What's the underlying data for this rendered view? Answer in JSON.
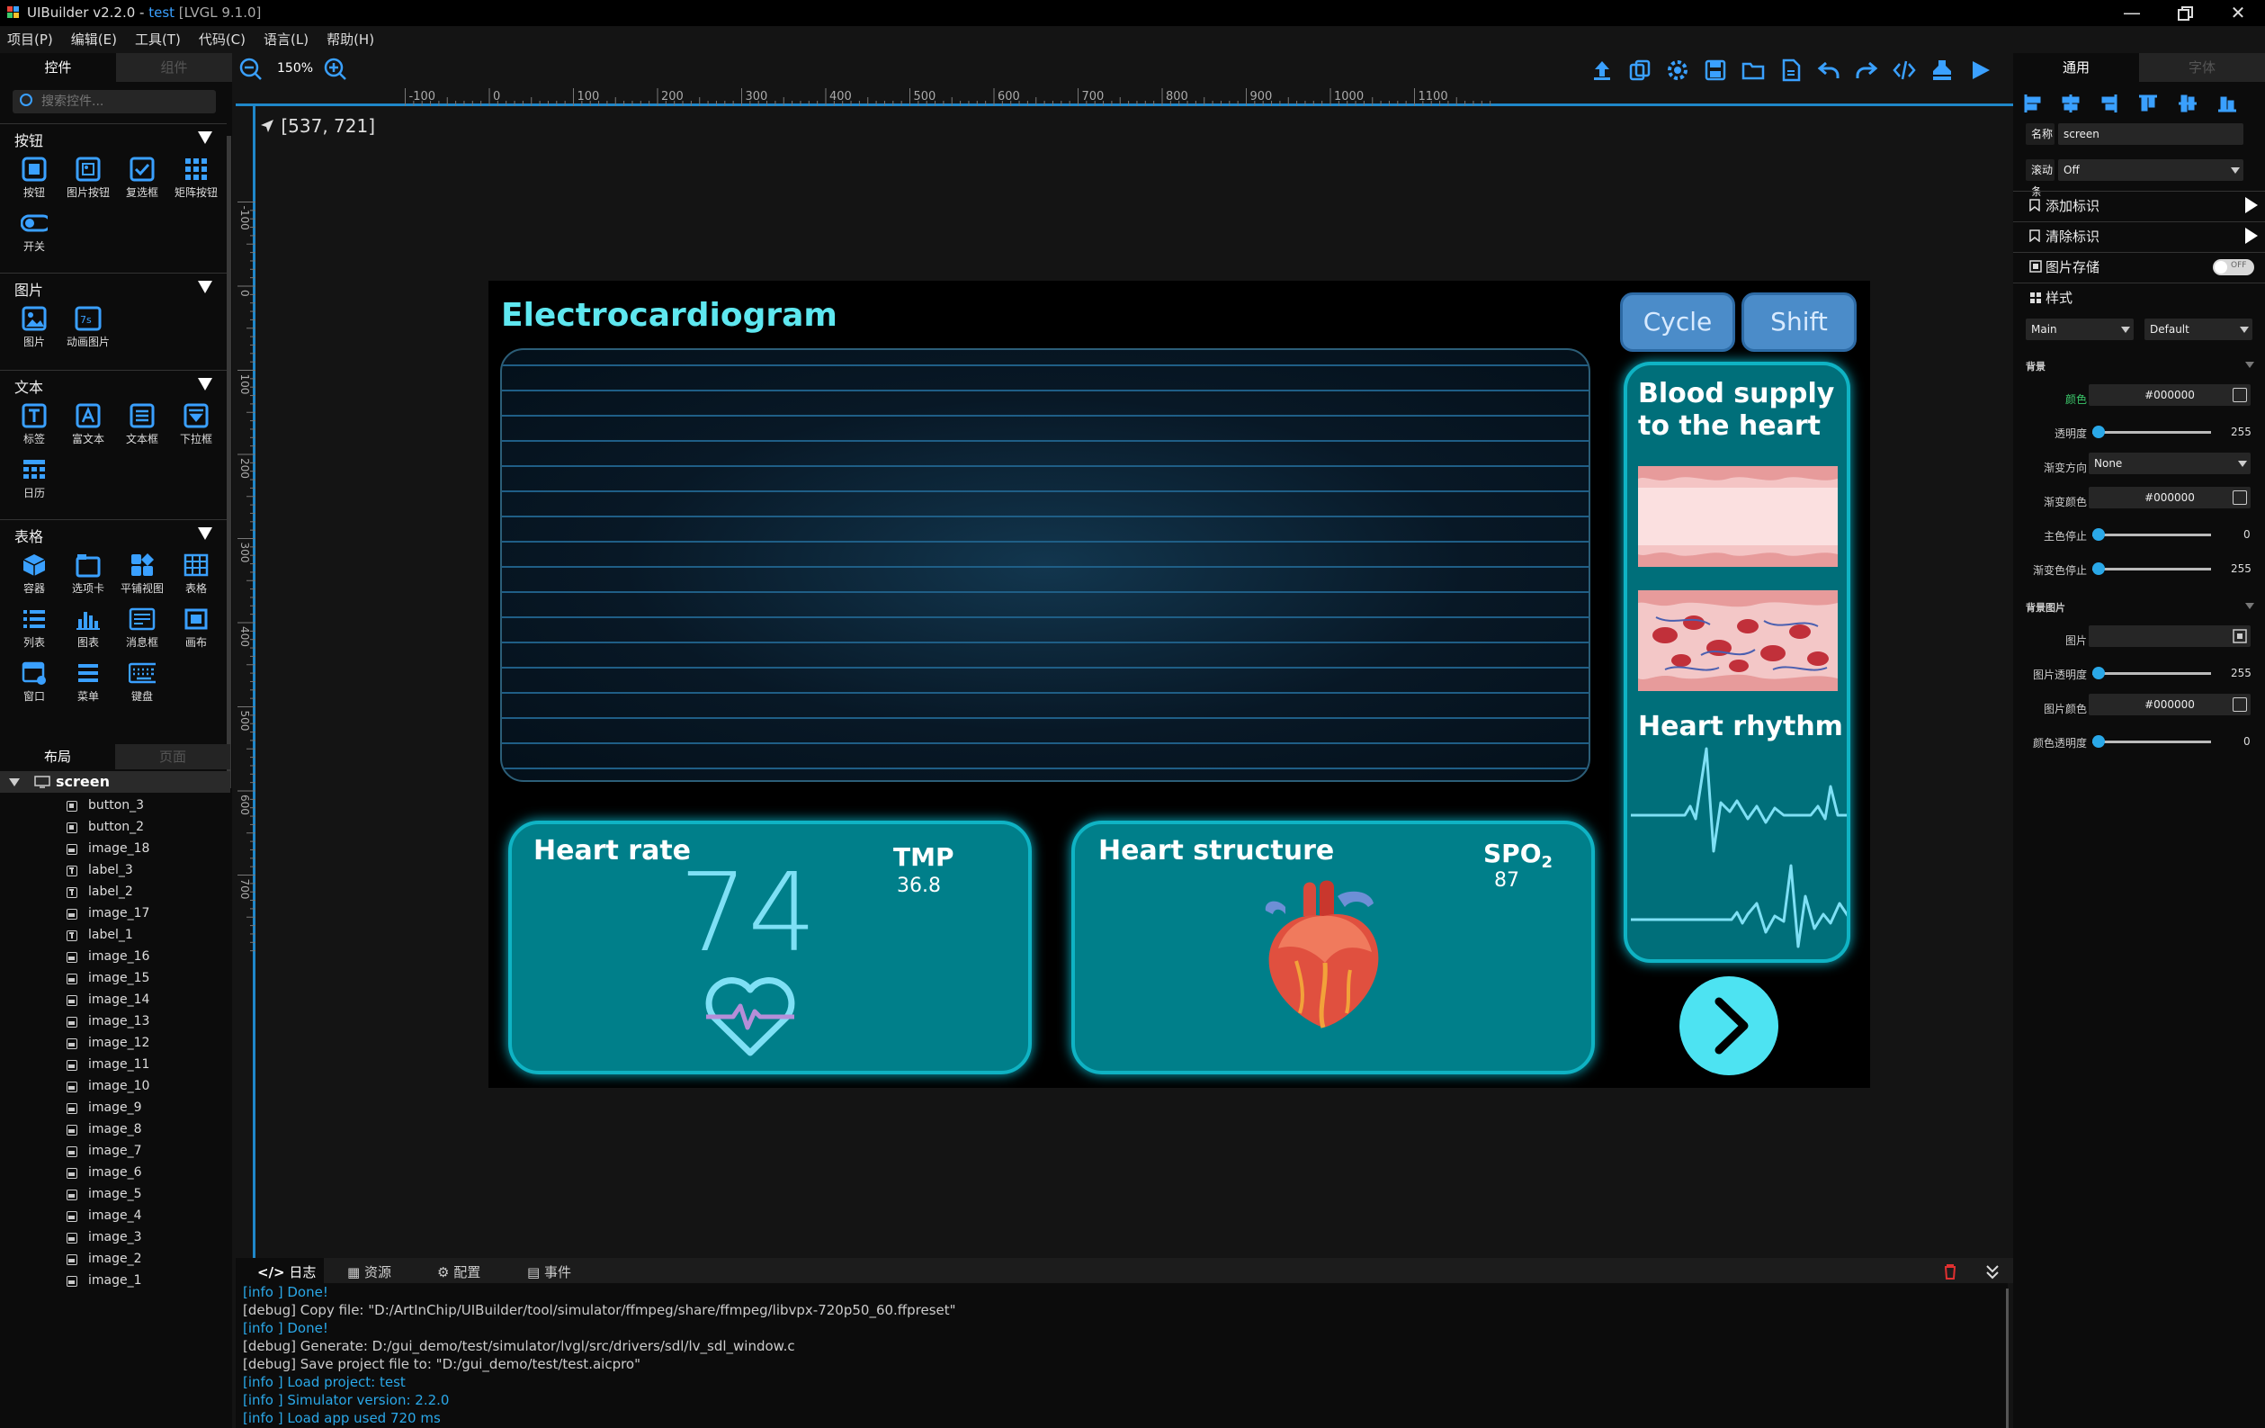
{
  "window": {
    "app_name": "UIBuilder v2.2.0 - ",
    "project": "test",
    "lvgl": " [LVGL 9.1.0]"
  },
  "menu": [
    "项目(P)",
    "编辑(E)",
    "工具(T)",
    "代码(C)",
    "语言(L)",
    "帮助(H)"
  ],
  "left_panel": {
    "tabs": [
      "控件",
      "组件"
    ],
    "search_placeholder": "搜索控件...",
    "categories": [
      {
        "name": "按钮",
        "items": [
          "按钮",
          "图片按钮",
          "复选框",
          "矩阵按钮",
          "开关"
        ]
      },
      {
        "name": "图片",
        "items": [
          "图片",
          "动画图片"
        ]
      },
      {
        "name": "文本",
        "items": [
          "标签",
          "富文本",
          "文本框",
          "下拉框",
          "日历"
        ]
      },
      {
        "name": "表格",
        "items": [
          "容器",
          "选项卡",
          "平铺视图",
          "表格",
          "列表",
          "图表",
          "消息框",
          "画布",
          "窗口",
          "菜单",
          "键盘"
        ]
      }
    ],
    "layout_tabs": [
      "布局",
      "页面"
    ],
    "tree_root": "screen",
    "tree": [
      {
        "type": "button",
        "name": "button_3"
      },
      {
        "type": "button",
        "name": "button_2"
      },
      {
        "type": "image",
        "name": "image_18"
      },
      {
        "type": "label",
        "name": "label_3"
      },
      {
        "type": "label",
        "name": "label_2"
      },
      {
        "type": "image",
        "name": "image_17"
      },
      {
        "type": "label",
        "name": "label_1"
      },
      {
        "type": "image",
        "name": "image_16"
      },
      {
        "type": "image",
        "name": "image_15"
      },
      {
        "type": "image",
        "name": "image_14"
      },
      {
        "type": "image",
        "name": "image_13"
      },
      {
        "type": "image",
        "name": "image_12"
      },
      {
        "type": "image",
        "name": "image_11"
      },
      {
        "type": "image",
        "name": "image_10"
      },
      {
        "type": "image",
        "name": "image_9"
      },
      {
        "type": "image",
        "name": "image_8"
      },
      {
        "type": "image",
        "name": "image_7"
      },
      {
        "type": "image",
        "name": "image_6"
      },
      {
        "type": "image",
        "name": "image_5"
      },
      {
        "type": "image",
        "name": "image_4"
      },
      {
        "type": "image",
        "name": "image_3"
      },
      {
        "type": "image",
        "name": "image_2"
      },
      {
        "type": "image",
        "name": "image_1"
      }
    ]
  },
  "toolbar": {
    "zoom": "150%",
    "tools": [
      "upload-icon",
      "copy-icon",
      "settings-icon",
      "save-icon",
      "open-folder-icon",
      "new-file-icon",
      "undo-icon",
      "redo-icon",
      "code-icon",
      "build-icon",
      "run-icon"
    ]
  },
  "rulers": {
    "h_labels": [
      "-100",
      "0",
      "100",
      "200",
      "300",
      "400",
      "500",
      "600",
      "700",
      "800",
      "900",
      "1000",
      "1100"
    ],
    "v_labels": [
      "-100",
      "0",
      "100",
      "200",
      "300",
      "400",
      "500",
      "600",
      "700"
    ]
  },
  "canvas": {
    "cursor_coord": "[537, 721]"
  },
  "device": {
    "title": "Electrocardiogram",
    "btn_cycle": "Cycle",
    "btn_shift": "Shift",
    "heart_rate": {
      "title": "Heart rate",
      "value": "74",
      "tmp_label": "TMP",
      "tmp_value": "36.8"
    },
    "heart_structure": {
      "title": "Heart structure",
      "spo_label": "SPO",
      "spo_sub": "2",
      "spo_value": "87"
    },
    "side": {
      "title": "Blood supply to the heart",
      "rhythm_title": "Heart rhythm"
    }
  },
  "log": {
    "tabs": [
      "日志",
      "资源",
      "配置",
      "事件"
    ],
    "lines": [
      {
        "level": "info",
        "text": "[info ] Done!"
      },
      {
        "level": "debug",
        "text": "[debug] Copy file: \"D:/ArtInChip/UIBuilder/tool/simulator/ffmpeg/share/ffmpeg/libvpx-720p50_60.ffpreset\""
      },
      {
        "level": "info",
        "text": "[info ] Done!"
      },
      {
        "level": "debug",
        "text": "[debug] Generate: D:/gui_demo/test/simulator/lvgl/src/drivers/sdl/lv_sdl_window.c"
      },
      {
        "level": "debug",
        "text": "[debug] Save project file to: \"D:/gui_demo/test/test.aicpro\""
      },
      {
        "level": "info",
        "text": "[info ] Load project: test"
      },
      {
        "level": "info",
        "text": "[info ] Simulator version: 2.2.0"
      },
      {
        "level": "info",
        "text": "[info ] Load app used 720 ms"
      }
    ]
  },
  "right_panel": {
    "tabs": [
      "通用",
      "字体"
    ],
    "name_label": "名称",
    "name_value": "screen",
    "scroll_label": "滚动条",
    "scroll_value": "Off",
    "add_flag": "添加标识",
    "clear_flag": "清除标识",
    "img_store": "图片存储",
    "img_store_toggle": "OFF",
    "style_title": "样式",
    "style_part": "Main",
    "style_state": "Default",
    "bg_section": "背景",
    "bg_img_section": "背景图片",
    "props": {
      "color_label": "颜色",
      "color_value": "#000000",
      "opa_label": "透明度",
      "opa_value": "255",
      "grad_dir_label": "渐变方向",
      "grad_dir_value": "None",
      "grad_color_label": "渐变颜色",
      "grad_color_value": "#000000",
      "main_stop_label": "主色停止",
      "main_stop_value": "0",
      "grad_stop_label": "渐变色停止",
      "grad_stop_value": "255",
      "img_label": "图片",
      "img_opa_label": "图片透明度",
      "img_opa_value": "255",
      "img_color_label": "图片颜色",
      "img_color_value": "#000000",
      "color_opa_label": "颜色透明度",
      "color_opa_value": "0"
    },
    "slider_levels": {
      "opa": 1.0,
      "main_stop": 0.0,
      "grad_stop": 1.0,
      "img_opa": 1.0,
      "color_opa": 0.0
    }
  },
  "colors": {
    "accent": "#2aa8e8",
    "screen_title": "#5ee7f0",
    "card_teal": "#007f8a",
    "card_border": "#0fb3c4",
    "button_blue": "#4b8cc9",
    "next_button": "#4de3f2",
    "log_info": "#2aa8e8"
  }
}
